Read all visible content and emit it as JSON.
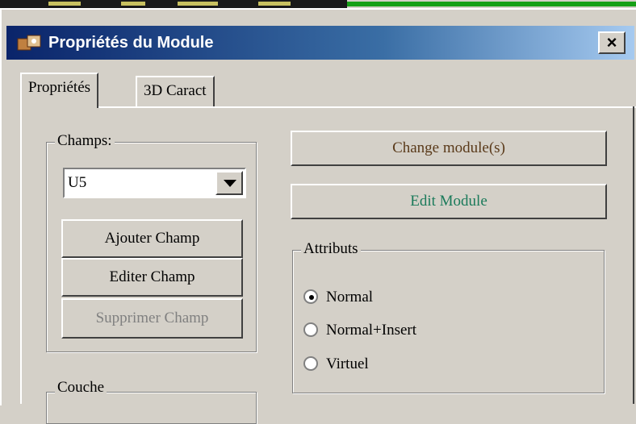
{
  "window": {
    "title": "Propriétés du Module",
    "close_label": "×"
  },
  "tabs": [
    {
      "label": "Propriétés",
      "active": true
    },
    {
      "label": "3D Caract",
      "active": false
    }
  ],
  "champs": {
    "legend": "Champs:",
    "selected": "U5",
    "buttons": {
      "add": "Ajouter Champ",
      "edit": "Editer Champ",
      "delete": "Supprimer Champ"
    }
  },
  "actions": {
    "change_module": "Change module(s)",
    "edit_module": "Edit Module"
  },
  "attributs": {
    "legend": "Attributs",
    "options": [
      {
        "label": "Normal",
        "selected": true
      },
      {
        "label": "Normal+Insert",
        "selected": false
      },
      {
        "label": "Virtuel",
        "selected": false
      }
    ]
  },
  "couche": {
    "legend": "Couche"
  },
  "colors": {
    "change_module_text": "#5a3a1a",
    "edit_module_text": "#1a7a5a",
    "disabled_text": "#808080"
  }
}
